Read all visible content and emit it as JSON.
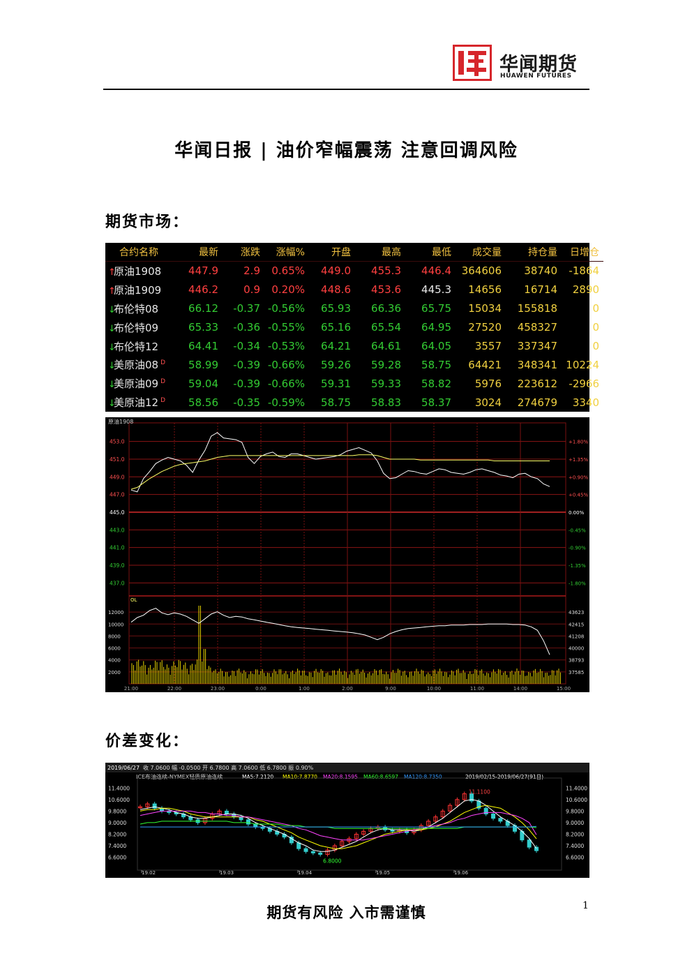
{
  "header": {
    "brand_cn": "华闻期货",
    "brand_en": "HUAWEN FUTURES",
    "logo_color": "#d6262b"
  },
  "title": "华闻日报 | 油价窄幅震荡 注意回调风险",
  "sections": {
    "futures_market": "期货市场：",
    "spread_change": "价差变化："
  },
  "quote_table": {
    "headers": [
      "合约名称",
      "最新",
      "涨跌",
      "涨幅%",
      "开盘",
      "最高",
      "最低",
      "成交量",
      "持仓量",
      "日增仓"
    ],
    "rows": [
      {
        "name": "原油1908",
        "dir": "up",
        "tag": "",
        "last": "447.9",
        "chg": "2.9",
        "pct": "0.65%",
        "open": "449.0",
        "high": "455.3",
        "low": "446.4",
        "volume": "364606",
        "oi": "38740",
        "oi_chg": "-1864",
        "low_color": "up"
      },
      {
        "name": "原油1909",
        "dir": "up",
        "tag": "",
        "last": "446.2",
        "chg": "0.9",
        "pct": "0.20%",
        "open": "448.6",
        "high": "453.6",
        "low": "445.3",
        "volume": "14656",
        "oi": "16714",
        "oi_chg": "2890",
        "low_color": "wh"
      },
      {
        "name": "布伦特08",
        "dir": "dn",
        "tag": "",
        "last": "66.12",
        "chg": "-0.37",
        "pct": "-0.56%",
        "open": "65.93",
        "high": "66.36",
        "low": "65.75",
        "volume": "15034",
        "oi": "155818",
        "oi_chg": "0",
        "low_color": "dn"
      },
      {
        "name": "布伦特09",
        "dir": "dn",
        "tag": "",
        "last": "65.33",
        "chg": "-0.36",
        "pct": "-0.55%",
        "open": "65.16",
        "high": "65.54",
        "low": "64.95",
        "volume": "27520",
        "oi": "458327",
        "oi_chg": "0",
        "low_color": "dn"
      },
      {
        "name": "布伦特12",
        "dir": "dn",
        "tag": "",
        "last": "64.41",
        "chg": "-0.34",
        "pct": "-0.53%",
        "open": "64.21",
        "high": "64.61",
        "low": "64.05",
        "volume": "3557",
        "oi": "337347",
        "oi_chg": "0",
        "low_color": "dn"
      },
      {
        "name": "美原油08",
        "dir": "dn",
        "tag": "D",
        "last": "58.99",
        "chg": "-0.39",
        "pct": "-0.66%",
        "open": "59.26",
        "high": "59.28",
        "low": "58.75",
        "volume": "64421",
        "oi": "348341",
        "oi_chg": "10224",
        "low_color": "dn"
      },
      {
        "name": "美原油09",
        "dir": "dn",
        "tag": "D",
        "last": "59.04",
        "chg": "-0.39",
        "pct": "-0.66%",
        "open": "59.31",
        "high": "59.33",
        "low": "58.82",
        "volume": "5976",
        "oi": "223612",
        "oi_chg": "-2966",
        "low_color": "dn"
      },
      {
        "name": "美原油12",
        "dir": "dn",
        "tag": "D",
        "last": "58.56",
        "chg": "-0.35",
        "pct": "-0.59%",
        "open": "58.75",
        "high": "58.83",
        "low": "58.37",
        "volume": "3024",
        "oi": "274679",
        "oi_chg": "3340",
        "low_color": "dn"
      }
    ]
  },
  "chart_data": [
    {
      "type": "line",
      "title": "原油1908",
      "price_ticks": [
        "453.0",
        "451.0",
        "449.0",
        "447.0",
        "445.0",
        "443.0",
        "441.0",
        "439.0",
        "437.0"
      ],
      "pct_ticks": [
        "+1.80%",
        "+1.35%",
        "+0.90%",
        "+0.45%",
        "0.00%",
        "-0.45%",
        "-0.90%",
        "-1.35%",
        "-1.80%"
      ],
      "ylim": [
        436.0,
        454.0
      ],
      "base_price": 445.0,
      "volume_ticks": [
        "12000",
        "10000",
        "8000",
        "6000",
        "4000",
        "2000"
      ],
      "oi_ticks": [
        "43623",
        "42415",
        "41208",
        "40000",
        "38793",
        "37585"
      ],
      "volume_label": "OL",
      "time_ticks": [
        "21:00",
        "22:00",
        "23:00",
        "0:00",
        "1:00",
        "2:00",
        "9:00",
        "10:00",
        "11:00",
        "14:00",
        "15:00"
      ],
      "series": [
        {
          "name": "price",
          "color": "#ffffff",
          "values": [
            447.5,
            447.3,
            448.8,
            449.6,
            450.5,
            450.9,
            451.2,
            451.0,
            450.8,
            450.3,
            449.5,
            450.9,
            452.0,
            453.6,
            454.0,
            453.4,
            453.3,
            453.2,
            452.9,
            451.2,
            450.5,
            451.3,
            451.6,
            451.8,
            451.3,
            451.2,
            451.6,
            451.6,
            451.4,
            451.2,
            451.0,
            451.1,
            451.2,
            451.3,
            451.5,
            451.9,
            452.1,
            452.3,
            452.0,
            451.7,
            450.8,
            449.4,
            448.8,
            448.9,
            449.3,
            449.7,
            449.6,
            449.4,
            449.3,
            449.6,
            449.9,
            449.8,
            449.5,
            449.4,
            449.3,
            449.5,
            449.8,
            449.9,
            449.7,
            449.5,
            449.2,
            449.1,
            448.9,
            449.3,
            449.4,
            449.0,
            448.8,
            448.2,
            447.9
          ]
        },
        {
          "name": "average",
          "color": "#ffff66",
          "values": [
            447.6,
            447.8,
            448.3,
            448.8,
            449.2,
            449.6,
            449.9,
            450.2,
            450.4,
            450.5,
            450.6,
            450.7,
            450.8,
            451.0,
            451.2,
            451.3,
            451.4,
            451.4,
            451.4,
            451.4,
            451.4,
            451.4,
            451.4,
            451.4,
            451.4,
            451.4,
            451.4,
            451.4,
            451.4,
            451.4,
            451.4,
            451.4,
            451.4,
            451.4,
            451.4,
            451.4,
            451.4,
            451.5,
            451.5,
            451.5,
            451.4,
            451.2,
            451.0,
            451.0,
            451.0,
            451.0,
            451.0,
            450.9,
            450.9,
            450.9,
            450.9,
            450.9,
            450.9,
            450.9,
            450.9,
            450.9,
            450.9,
            450.9,
            450.9,
            450.8,
            450.8,
            450.8,
            450.8,
            450.8,
            450.8,
            450.8,
            450.8,
            450.8,
            450.8
          ]
        },
        {
          "name": "open_interest",
          "color": "#ffffff",
          "values": [
            42300,
            42700,
            42900,
            43300,
            43500,
            43100,
            42950,
            43100,
            43000,
            42800,
            42500,
            42200,
            42600,
            43000,
            43200,
            42900,
            42700,
            42800,
            42750,
            42600,
            42500,
            42400,
            42300,
            42200,
            42100,
            42000,
            41900,
            41850,
            41800,
            41750,
            41700,
            41650,
            41600,
            41550,
            41500,
            41450,
            41400,
            41300,
            41200,
            41000,
            40800,
            41000,
            41300,
            41500,
            41650,
            41750,
            41800,
            41850,
            41900,
            41950,
            42000,
            42000,
            42050,
            42050,
            42050,
            42100,
            42100,
            42100,
            42150,
            42150,
            42150,
            42150,
            42100,
            42100,
            42050,
            41900,
            41600,
            40700,
            39500
          ]
        }
      ]
    },
    {
      "type": "line",
      "title": "ICE布油连续-NYMEX轻质原油连续",
      "date_label": "2019/06/27",
      "header_stats": "收 7.0600  幅 -0.0500  开 6.7800  高 7.0600  低 6.7800  振 0.90%",
      "legend": [
        "MA5:7.2120",
        "MA10:7.8770",
        "MA20:8.1595",
        "MA60:8.6597",
        "MA120:8.7350"
      ],
      "range_label": "2019/02/15-2019/06/27(91日)",
      "y_ticks": [
        "11.4000",
        "10.6000",
        "9.8000",
        "9.0000",
        "8.2000",
        "7.4000",
        "6.6000"
      ],
      "ylim": [
        6.0,
        11.8
      ],
      "x_ticks": [
        "19.02",
        "19.03",
        "19.04",
        "19.05",
        "19.06"
      ],
      "annotations": [
        "11.1100",
        "6.8000"
      ],
      "series": [
        {
          "name": "close",
          "color": "#33cccc",
          "values": [
            10.1,
            10.3,
            10.0,
            9.8,
            9.7,
            9.6,
            9.4,
            9.2,
            9.0,
            9.3,
            9.6,
            9.8,
            9.6,
            9.4,
            9.2,
            8.9,
            8.7,
            8.6,
            8.4,
            8.2,
            8.0,
            7.6,
            7.2,
            7.0,
            6.9,
            6.8,
            7.1,
            7.4,
            7.7,
            7.9,
            8.2,
            8.4,
            8.6,
            8.7,
            8.5,
            8.4,
            8.5,
            8.3,
            8.5,
            8.8,
            9.1,
            9.4,
            9.8,
            10.2,
            10.6,
            11.0,
            10.5,
            10.0,
            9.6,
            9.3,
            9.1,
            8.8,
            8.4,
            7.8,
            7.3,
            7.06
          ]
        },
        {
          "name": "MA5",
          "color": "#ffffff",
          "values": [
            9.9,
            10.0,
            10.1,
            10.0,
            9.9,
            9.7,
            9.6,
            9.4,
            9.3,
            9.3,
            9.4,
            9.5,
            9.6,
            9.6,
            9.5,
            9.3,
            9.0,
            8.8,
            8.6,
            8.4,
            8.2,
            7.9,
            7.6,
            7.4,
            7.1,
            7.0,
            7.0,
            7.1,
            7.3,
            7.5,
            7.7,
            8.0,
            8.3,
            8.5,
            8.6,
            8.5,
            8.5,
            8.5,
            8.4,
            8.5,
            8.7,
            9.0,
            9.3,
            9.7,
            10.1,
            10.5,
            10.6,
            10.5,
            10.2,
            9.8,
            9.4,
            9.1,
            8.8,
            8.4,
            7.9,
            7.21
          ]
        },
        {
          "name": "MA10",
          "color": "#ffff00",
          "values": [
            9.8,
            9.9,
            9.9,
            10.0,
            10.0,
            9.9,
            9.8,
            9.6,
            9.5,
            9.4,
            9.4,
            9.4,
            9.4,
            9.4,
            9.4,
            9.4,
            9.2,
            9.1,
            8.9,
            8.7,
            8.5,
            8.3,
            8.0,
            7.8,
            7.6,
            7.4,
            7.3,
            7.2,
            7.2,
            7.3,
            7.4,
            7.6,
            7.8,
            8.0,
            8.2,
            8.3,
            8.4,
            8.5,
            8.5,
            8.5,
            8.6,
            8.7,
            8.9,
            9.1,
            9.4,
            9.7,
            9.9,
            10.1,
            10.2,
            10.1,
            10.0,
            9.7,
            9.4,
            9.0,
            8.5,
            7.88
          ]
        },
        {
          "name": "MA20",
          "color": "#ff44ff",
          "values": [
            9.5,
            9.6,
            9.7,
            9.8,
            9.8,
            9.8,
            9.8,
            9.8,
            9.7,
            9.7,
            9.6,
            9.6,
            9.5,
            9.5,
            9.4,
            9.4,
            9.3,
            9.2,
            9.1,
            9.0,
            8.9,
            8.8,
            8.6,
            8.5,
            8.3,
            8.1,
            8.0,
            7.9,
            7.8,
            7.8,
            7.8,
            7.8,
            7.9,
            8.0,
            8.1,
            8.2,
            8.3,
            8.4,
            8.5,
            8.6,
            8.7,
            8.8,
            8.9,
            9.0,
            9.2,
            9.3,
            9.5,
            9.6,
            9.7,
            9.7,
            9.7,
            9.6,
            9.5,
            9.3,
            9.0,
            8.16
          ]
        },
        {
          "name": "MA60",
          "color": "#33ff33",
          "values": [
            8.9,
            9.0,
            9.0,
            9.1,
            9.1,
            9.1,
            9.1,
            9.1,
            9.1,
            9.1,
            9.1,
            9.1,
            9.1,
            9.0,
            9.0,
            9.0,
            8.9,
            8.9,
            8.9,
            8.9,
            8.8,
            8.8,
            8.8,
            8.7,
            8.7,
            8.7,
            8.7,
            8.6,
            8.6,
            8.6,
            8.6,
            8.6,
            8.6,
            8.6,
            8.6,
            8.6,
            8.6,
            8.6,
            8.6,
            8.6,
            8.6,
            8.6,
            8.6,
            8.6,
            8.6,
            8.7,
            8.7,
            8.7,
            8.7,
            8.7,
            8.7,
            8.7,
            8.7,
            8.7,
            8.7,
            8.66
          ]
        },
        {
          "name": "MA120",
          "color": "#3399ff",
          "values": [
            8.7,
            8.7,
            8.7,
            8.7,
            8.7,
            8.7,
            8.7,
            8.7,
            8.7,
            8.7,
            8.7,
            8.7,
            8.7,
            8.7,
            8.7,
            8.7,
            8.7,
            8.7,
            8.7,
            8.7,
            8.7,
            8.7,
            8.7,
            8.7,
            8.7,
            8.7,
            8.7,
            8.7,
            8.7,
            8.7,
            8.7,
            8.7,
            8.7,
            8.7,
            8.7,
            8.7,
            8.7,
            8.7,
            8.7,
            8.7,
            8.7,
            8.7,
            8.7,
            8.7,
            8.7,
            8.7,
            8.7,
            8.7,
            8.7,
            8.7,
            8.7,
            8.7,
            8.7,
            8.7,
            8.7,
            8.74
          ]
        }
      ]
    }
  ],
  "footer": {
    "slogan": "期货有风险 入市需谨慎",
    "page_number": "1"
  }
}
